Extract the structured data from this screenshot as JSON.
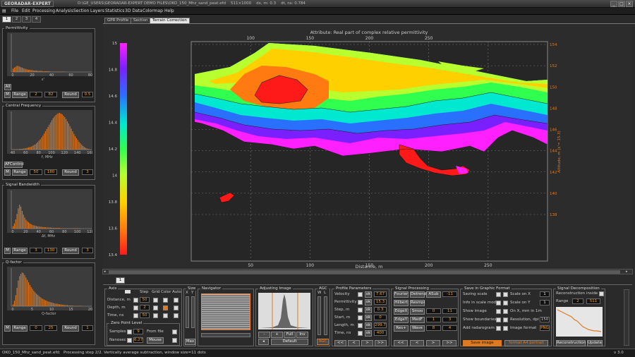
{
  "window": {
    "logo": "GEORADAR-EXPERT",
    "path": "D:\\GE_USERS\\GEORADAR-EXPERT DEMO FILES\\OKO_150_Mhz_sand_peat.efd",
    "dims": "511×1000",
    "dx": "dx, m: 0.3",
    "dt": "dt, ns: 0.784"
  },
  "menu": [
    "File",
    "Edit",
    "Processing",
    "Analysis",
    "Section",
    "Layers",
    "Statistics",
    "3D Data",
    "Colormap",
    "Help"
  ],
  "left_tabs": [
    "1",
    "2",
    "3",
    "4"
  ],
  "panels": [
    {
      "title": "Permittivity",
      "xlabel": "ε'",
      "xticks": [
        "0",
        "20",
        "40",
        "60",
        "80"
      ],
      "row": [
        "All"
      ],
      "range_label": "Range",
      "v1": "2",
      "v2": "82",
      "round_label": "Round",
      "v3": "0.5",
      "hist": [
        9,
        12,
        14,
        17,
        16,
        15,
        13,
        12,
        10,
        9,
        8,
        7,
        6,
        6,
        5,
        5,
        4,
        4,
        4,
        3,
        3,
        3,
        3,
        2,
        2,
        2,
        2,
        2,
        2,
        1,
        1,
        1,
        1,
        1,
        1,
        1,
        1,
        1,
        1,
        1,
        1,
        0,
        0,
        0,
        0,
        0,
        0,
        0,
        0,
        0,
        0,
        0,
        0,
        0,
        0,
        0,
        0,
        0,
        0,
        0
      ]
    },
    {
      "title": "Central Frequency",
      "xlabel": "f, MHz",
      "xticks": [
        "40",
        "60",
        "80",
        "100",
        "120",
        "140",
        "160"
      ],
      "row": [
        "AFControl"
      ],
      "range_label": "Range",
      "v1": "50",
      "v2": "180",
      "round_label": "Round",
      "v3": "3",
      "hist": [
        1,
        1,
        1,
        1,
        1,
        2,
        2,
        2,
        3,
        3,
        4,
        5,
        6,
        7,
        8,
        10,
        12,
        14,
        17,
        20,
        24,
        28,
        33,
        38,
        44,
        50,
        56,
        62,
        68,
        74,
        80,
        86,
        90,
        94,
        97,
        99,
        100,
        98,
        96,
        92,
        88,
        83,
        77,
        71,
        64,
        57,
        50,
        43,
        37,
        31,
        26,
        21,
        17,
        13,
        10,
        7,
        5,
        3,
        2,
        1
      ]
    },
    {
      "title": "Signal Bandwidth",
      "xlabel": "Δf, MHz",
      "xticks": [
        "0",
        "20",
        "40",
        "60",
        "80",
        "100",
        "120"
      ],
      "row": [],
      "range_label": "Range",
      "v1": "3",
      "v2": "130",
      "round_label": "Round",
      "v3": "3",
      "hist": [
        7,
        14,
        25,
        40,
        55,
        65,
        60,
        48,
        38,
        30,
        24,
        20,
        17,
        14,
        12,
        10,
        9,
        8,
        7,
        6,
        6,
        5,
        5,
        4,
        4,
        4,
        3,
        3,
        3,
        3,
        2,
        2,
        2,
        2,
        2,
        2,
        2,
        1,
        1,
        1,
        1,
        1,
        1,
        1,
        1,
        1,
        1,
        1,
        1,
        1,
        1,
        1,
        1,
        0,
        0,
        0,
        0,
        0,
        0,
        0
      ]
    },
    {
      "title": "Q-factor",
      "xlabel": "Q-factor",
      "xticks": [
        "0",
        "5",
        "10",
        "15",
        "20"
      ],
      "row": [],
      "range_label": "Range",
      "v1": "0",
      "v2": "25",
      "round_label": "Round",
      "v3": "1",
      "hist": [
        5,
        15,
        30,
        50,
        70,
        82,
        88,
        92,
        90,
        85,
        78,
        72,
        65,
        58,
        52,
        47,
        42,
        38,
        34,
        31,
        28,
        25,
        22,
        20,
        18,
        16,
        15,
        13,
        12,
        11,
        10,
        9,
        8,
        7,
        7,
        6,
        5,
        5,
        4,
        4,
        3,
        3,
        3,
        2,
        2,
        2,
        2,
        1,
        1,
        1,
        1,
        1,
        1,
        1,
        0,
        0,
        0,
        0,
        0,
        0
      ]
    }
  ],
  "m_label": "M",
  "main_tabs": [
    "GPR Profile",
    "Section",
    "Terrain Correction"
  ],
  "chart_data": {
    "type": "heatmap",
    "title": "Attribute:  Real part of complex relative permittivity",
    "xlabel": "Distance, m",
    "ylabel": "Altitude, m (ε'= 15.3)",
    "x_top_ticks": [
      "100",
      "150",
      "200",
      "250"
    ],
    "x_bottom_ticks": [
      "50",
      "100",
      "150",
      "200",
      "250"
    ],
    "y_right_ticks": [
      "154",
      "152",
      "150",
      "148",
      "146",
      "144",
      "142",
      "140",
      "138"
    ],
    "colorbar_ticks": [
      "15",
      "14.8",
      "14.6",
      "14.4",
      "14.2",
      "14",
      "13.8",
      "13.6",
      "13.4"
    ],
    "colorbar_colors": [
      "#ff1a1a",
      "#ff7a10",
      "#ffd000",
      "#b8ff30",
      "#30ff50",
      "#00e8d0",
      "#2a70ff",
      "#7a20ff",
      "#ff20ff"
    ]
  },
  "bottom_tab": "1",
  "axis": {
    "title": "Axis",
    "col_step": "Step",
    "col_grid": "Grid",
    "col_color": "Color",
    "col_auto": "Auto",
    "rows": [
      {
        "label": "Distance, m",
        "v": "50"
      },
      {
        "label": "Depth, m",
        "v": "2"
      },
      {
        "label": "Time, ns",
        "v": "50"
      }
    ],
    "zp_title": "Zero Point Level",
    "samples_label": "Samples",
    "samples": "9",
    "fromfile": "From file",
    "nanosec_label": "Nanosec",
    "nanosec": "6.27",
    "mouse": "Mouse"
  },
  "size": {
    "title": "Size",
    "x": "X",
    "y": "Y",
    "max": "Max"
  },
  "navigator": {
    "title": "Navigator"
  },
  "adjust": {
    "title": "Adjusting Image",
    "btns": [
      "-",
      "+",
      "Full",
      "Inv"
    ],
    "default": "Default"
  },
  "agc": {
    "title": "AGC",
    "w": "W",
    "l": "L",
    "btn": "AGC"
  },
  "profile": {
    "title": "Profile Parameters",
    "rows": [
      {
        "label": "Velocity",
        "v": "7.67"
      },
      {
        "label": "Permittivity",
        "v": "15.3"
      },
      {
        "label": "Step, m",
        "v": "0.3"
      },
      {
        "label": "Start, m",
        "v": "0"
      },
      {
        "label": "Length, m",
        "v": "299.7"
      },
      {
        "label": "Time, ns",
        "v": "400"
      }
    ],
    "ok": "ok",
    "nav": [
      "<<",
      "<",
      ">",
      ">>"
    ]
  },
  "signal": {
    "title": "Signal Processing",
    "rows": [
      [
        "Fourier",
        "Detrend",
        "ASub",
        "-11"
      ],
      [
        "Hilbert",
        "Resmpl",
        "",
        ""
      ],
      [
        "EdgeX",
        "Smoo",
        "0",
        "11"
      ],
      [
        "EdgeY",
        "MedF",
        "1",
        "3"
      ],
      [
        "Res+",
        "Wave",
        "8",
        "4"
      ]
    ]
  },
  "save": {
    "title": "Save in Graphic Format",
    "rows": [
      "Saving scale",
      "Info in scale mode",
      "Show image",
      "Show boundaries",
      "Add radarogram"
    ],
    "right": [
      {
        "label": "Scale on X",
        "v": "1"
      },
      {
        "label": "Scale on Y",
        "v": "1"
      },
      {
        "label": "On X, mm in 1m",
        "v": ""
      },
      {
        "label": "Resolution, dpi",
        "v": "150"
      },
      {
        "label": "Image format",
        "v": "PNG"
      }
    ],
    "save_btn": "Save image",
    "format_btn": "format A4 portrait"
  },
  "decomp": {
    "title": "Signal Decomposition",
    "recon_inside": "Reconstruction inside",
    "range": "Range",
    "v1": "2",
    "v2": "511",
    "recon_btn": "Reconstruction",
    "update_btn": "Update"
  },
  "status": {
    "file": "OKO_150_Mhz_sand_peat.efd:",
    "step": "Processing step 2/2. Vertically average subtraction, window size=11 dots",
    "ver": "v 3.0"
  }
}
